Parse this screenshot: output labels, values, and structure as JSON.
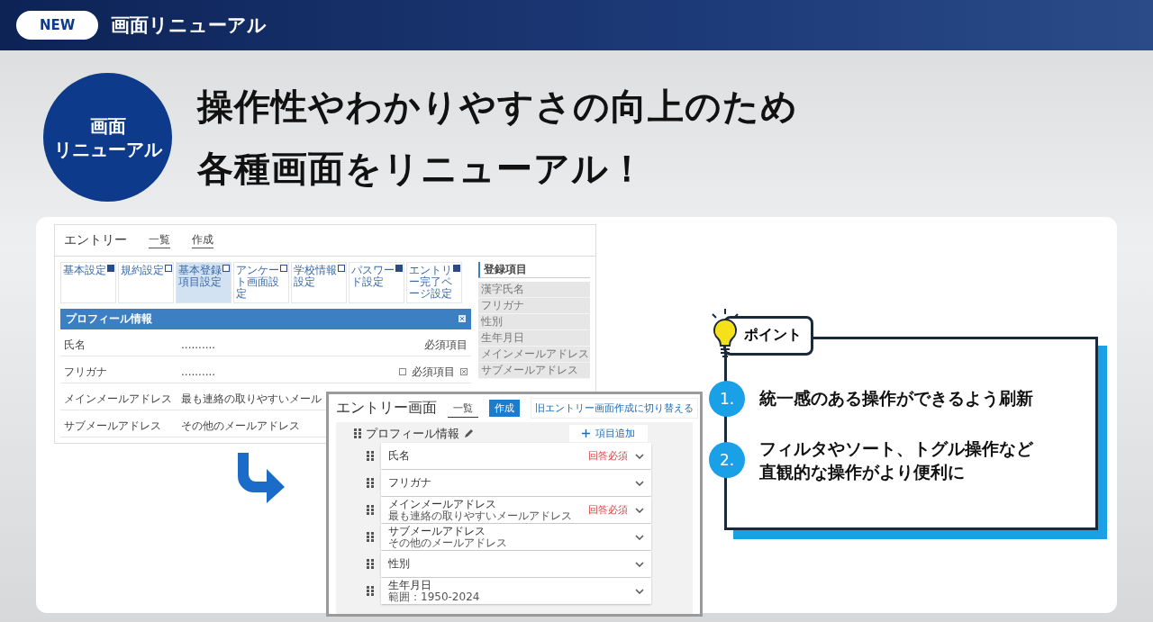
{
  "header": {
    "badge": "NEW",
    "title": "画面リニューアル"
  },
  "hero": {
    "circle_label": [
      "画面",
      "リニューアル"
    ],
    "headline": [
      "操作性やわかりやすさの向上のため",
      "各種画面をリニューアル！"
    ]
  },
  "old_screen": {
    "title": "エントリー",
    "nav": [
      "一覧",
      "作成"
    ],
    "tabs": [
      {
        "label": "基本設定",
        "checked": true,
        "selected": false
      },
      {
        "label": "規約設定",
        "checked": false,
        "selected": false
      },
      {
        "label": "基本登録項目設定",
        "checked": false,
        "selected": true
      },
      {
        "label": "アンケート画面設定",
        "checked": false,
        "selected": false
      },
      {
        "label": "学校情報設定",
        "checked": false,
        "selected": false
      },
      {
        "label": "パスワード設定",
        "checked": true,
        "selected": false
      },
      {
        "label": "エントリー完了ページ設定",
        "checked": true,
        "selected": false
      }
    ],
    "section": "プロフィール情報",
    "rows": [
      {
        "label": "氏名",
        "value": "..........",
        "note": "必須項目",
        "kind": "plain"
      },
      {
        "label": "フリガナ",
        "value": "..........",
        "note": "必須項目",
        "kind": "checkbox",
        "checked": false
      },
      {
        "label": "メインメールアドレス",
        "value": "最も連絡の取りやすいメール",
        "kind": "plain"
      },
      {
        "label": "サブメールアドレス",
        "value": "その他のメールアドレス",
        "kind": "plain"
      }
    ],
    "side": {
      "title": "登録項目",
      "items": [
        "漢字氏名",
        "フリガナ",
        "性別",
        "生年月日",
        "メインメールアドレス",
        "サブメールアドレス"
      ]
    }
  },
  "new_screen": {
    "title": "エントリー画面",
    "nav": [
      {
        "label": "一覧",
        "selected": false
      },
      {
        "label": "作成",
        "selected": true
      }
    ],
    "switch_link": "旧エントリー画面作成に切り替える",
    "section": "プロフィール情報",
    "add_button": "項目追加",
    "fields": [
      {
        "label": "氏名",
        "required_label": "回答必須"
      },
      {
        "label": "フリガナ"
      },
      {
        "label": "メインメールアドレス",
        "sub": "最も連絡の取りやすいメールアドレス",
        "required_label": "回答必須"
      },
      {
        "label": "サブメールアドレス",
        "sub": "その他のメールアドレス"
      },
      {
        "label": "性別"
      },
      {
        "label": "生年月日",
        "sub": "範囲：1950-2024"
      }
    ]
  },
  "points": {
    "label": "ポイント",
    "items": [
      {
        "number": "1.",
        "text": "統一感のある操作ができるよう刷新"
      },
      {
        "number": "2.",
        "text": "フィルタやソート、トグル操作など直観的な操作がより便利に"
      }
    ]
  }
}
